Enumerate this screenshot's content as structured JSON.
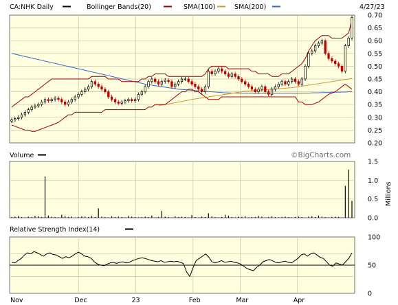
{
  "header": {
    "symbol_label": "CA:NHK Daily",
    "bollinger_label": "Bollinger Bands(20)",
    "sma100_label": "SMA(100)",
    "sma200_label": "SMA(200)",
    "date_label": "4/27/23"
  },
  "colors": {
    "panel_bg": "#ffffe0",
    "grid": "#c8c8a8",
    "up_candle": "#000000",
    "down_candle": "#c00000",
    "bollinger": "#a00000",
    "sma100": "#cc9933",
    "sma200": "#3366cc",
    "volume": "#000000",
    "rsi": "#000000"
  },
  "volume_panel": {
    "title": "Volume",
    "watermark": "©BigCharts.com",
    "unit_label": "Millions"
  },
  "rsi_panel": {
    "title": "Relative Strength Index(14)"
  },
  "chart_data": [
    {
      "type": "candlestick",
      "title": "CA:NHK Daily",
      "ylim": [
        0.2,
        0.7
      ],
      "y_ticks": [
        "0.70",
        "0.65",
        "0.60",
        "0.55",
        "0.50",
        "0.45",
        "0.40",
        "0.35",
        "0.30",
        "0.25",
        "0.20"
      ],
      "x_ticks": [
        "Nov",
        "Dec",
        "23",
        "Feb",
        "Mar",
        "Apr"
      ],
      "grid": true,
      "legend": [
        "Bollinger Bands(20)",
        "SMA(100)",
        "SMA(200)"
      ],
      "closes": [
        0.29,
        0.295,
        0.3,
        0.31,
        0.32,
        0.33,
        0.34,
        0.345,
        0.35,
        0.36,
        0.37,
        0.365,
        0.37,
        0.375,
        0.37,
        0.36,
        0.35,
        0.36,
        0.37,
        0.38,
        0.39,
        0.4,
        0.41,
        0.42,
        0.44,
        0.43,
        0.42,
        0.41,
        0.4,
        0.38,
        0.37,
        0.36,
        0.355,
        0.36,
        0.365,
        0.37,
        0.365,
        0.37,
        0.39,
        0.4,
        0.42,
        0.44,
        0.45,
        0.44,
        0.43,
        0.44,
        0.445,
        0.44,
        0.42,
        0.43,
        0.44,
        0.45,
        0.45,
        0.44,
        0.43,
        0.42,
        0.41,
        0.4,
        0.42,
        0.48,
        0.47,
        0.48,
        0.49,
        0.48,
        0.47,
        0.46,
        0.47,
        0.46,
        0.45,
        0.44,
        0.43,
        0.42,
        0.41,
        0.4,
        0.41,
        0.42,
        0.4,
        0.39,
        0.41,
        0.42,
        0.43,
        0.44,
        0.43,
        0.44,
        0.45,
        0.44,
        0.43,
        0.45,
        0.5,
        0.55,
        0.56,
        0.58,
        0.59,
        0.6,
        0.55,
        0.53,
        0.52,
        0.51,
        0.5,
        0.48,
        0.58,
        0.61,
        0.69
      ],
      "bollinger_upper": [
        0.34,
        0.35,
        0.36,
        0.37,
        0.38,
        0.38,
        0.39,
        0.4,
        0.41,
        0.42,
        0.43,
        0.44,
        0.45,
        0.45,
        0.45,
        0.45,
        0.45,
        0.45,
        0.45,
        0.45,
        0.45,
        0.45,
        0.45,
        0.45,
        0.46,
        0.46,
        0.46,
        0.46,
        0.46,
        0.45,
        0.45,
        0.45,
        0.45,
        0.44,
        0.44,
        0.44,
        0.44,
        0.44,
        0.44,
        0.45,
        0.45,
        0.46,
        0.46,
        0.47,
        0.47,
        0.47,
        0.47,
        0.46,
        0.46,
        0.46,
        0.46,
        0.46,
        0.46,
        0.46,
        0.46,
        0.46,
        0.46,
        0.46,
        0.47,
        0.49,
        0.5,
        0.5,
        0.5,
        0.5,
        0.5,
        0.49,
        0.49,
        0.49,
        0.49,
        0.49,
        0.49,
        0.49,
        0.48,
        0.48,
        0.47,
        0.47,
        0.47,
        0.47,
        0.46,
        0.46,
        0.46,
        0.47,
        0.47,
        0.47,
        0.48,
        0.49,
        0.5,
        0.51,
        0.53,
        0.56,
        0.58,
        0.6,
        0.61,
        0.62,
        0.62,
        0.62,
        0.61,
        0.61,
        0.61,
        0.61,
        0.62,
        0.63,
        0.68
      ],
      "bollinger_lower": [
        0.27,
        0.265,
        0.26,
        0.255,
        0.25,
        0.25,
        0.245,
        0.245,
        0.25,
        0.255,
        0.26,
        0.265,
        0.27,
        0.275,
        0.28,
        0.29,
        0.3,
        0.31,
        0.31,
        0.32,
        0.32,
        0.32,
        0.32,
        0.32,
        0.32,
        0.32,
        0.32,
        0.32,
        0.33,
        0.33,
        0.33,
        0.33,
        0.33,
        0.33,
        0.33,
        0.33,
        0.33,
        0.33,
        0.33,
        0.33,
        0.33,
        0.34,
        0.34,
        0.35,
        0.35,
        0.35,
        0.35,
        0.36,
        0.37,
        0.38,
        0.39,
        0.4,
        0.4,
        0.41,
        0.41,
        0.4,
        0.4,
        0.39,
        0.38,
        0.37,
        0.37,
        0.37,
        0.37,
        0.38,
        0.38,
        0.38,
        0.38,
        0.38,
        0.38,
        0.38,
        0.38,
        0.38,
        0.38,
        0.38,
        0.38,
        0.38,
        0.38,
        0.38,
        0.38,
        0.38,
        0.38,
        0.38,
        0.38,
        0.38,
        0.38,
        0.38,
        0.36,
        0.36,
        0.35,
        0.35,
        0.35,
        0.355,
        0.36,
        0.37,
        0.38,
        0.39,
        0.395,
        0.4,
        0.41,
        0.42,
        0.43,
        0.42,
        0.41
      ],
      "sma100": [
        null,
        null,
        null,
        null,
        null,
        null,
        null,
        null,
        null,
        null,
        null,
        null,
        null,
        null,
        null,
        null,
        null,
        null,
        null,
        null,
        null,
        null,
        null,
        null,
        null,
        null,
        null,
        null,
        null,
        null,
        null,
        null,
        null,
        null,
        null,
        null,
        null,
        null,
        null,
        null,
        null,
        null,
        null,
        null,
        0.345,
        0.348,
        0.35,
        0.352,
        0.355,
        0.357,
        0.36,
        0.362,
        0.365,
        0.367,
        0.37,
        0.372,
        0.374,
        0.376,
        0.378,
        0.38,
        0.382,
        0.384,
        0.386,
        0.388,
        0.39,
        0.392,
        0.394,
        0.396,
        0.398,
        0.4,
        0.402,
        0.403,
        0.404,
        0.405,
        0.406,
        0.407,
        0.408,
        0.409,
        0.41,
        0.411,
        0.412,
        0.413,
        0.414,
        0.415,
        0.416,
        0.418,
        0.42,
        0.422,
        0.424,
        0.426,
        0.428,
        0.43,
        0.432,
        0.434,
        0.436,
        0.438,
        0.44,
        0.442,
        0.444,
        0.446,
        0.448,
        0.45,
        0.452
      ],
      "sma200": [
        0.55,
        0.547,
        0.544,
        0.541,
        0.538,
        0.535,
        0.532,
        0.529,
        0.526,
        0.523,
        0.52,
        0.517,
        0.514,
        0.511,
        0.508,
        0.505,
        0.502,
        0.499,
        0.496,
        0.493,
        0.49,
        0.487,
        0.484,
        0.481,
        0.478,
        0.475,
        0.472,
        0.469,
        0.466,
        0.463,
        0.46,
        0.457,
        0.454,
        0.451,
        0.448,
        0.445,
        0.442,
        0.439,
        0.436,
        0.433,
        0.43,
        0.428,
        0.426,
        0.424,
        0.422,
        0.42,
        0.418,
        0.416,
        0.414,
        0.412,
        0.41,
        0.409,
        0.408,
        0.407,
        0.406,
        0.405,
        0.404,
        0.403,
        0.402,
        0.401,
        0.4,
        0.399,
        0.398,
        0.397,
        0.396,
        0.396,
        0.395,
        0.395,
        0.395,
        0.395,
        0.394,
        0.394,
        0.394,
        0.394,
        0.394,
        0.394,
        0.394,
        0.394,
        0.394,
        0.394,
        0.394,
        0.394,
        0.394,
        0.394,
        0.394,
        0.394,
        0.394,
        0.395,
        0.395,
        0.395,
        0.396,
        0.396,
        0.396,
        0.397,
        0.397,
        0.397,
        0.398,
        0.398,
        0.398,
        0.399,
        0.399,
        0.4,
        0.4
      ]
    },
    {
      "type": "bar",
      "title": "Volume",
      "ylim": [
        0,
        1.5
      ],
      "y_ticks": [
        "1.5",
        "1.0",
        "0.5",
        "0.0"
      ],
      "ylabel": "Millions",
      "values": [
        0.02,
        0.03,
        0.05,
        0.02,
        0.01,
        0.03,
        0.02,
        0.05,
        0.04,
        0.02,
        1.1,
        0.06,
        0.03,
        0.02,
        0.01,
        0.08,
        0.05,
        0.02,
        0.03,
        0.01,
        0.02,
        0.04,
        0.03,
        0.02,
        0.05,
        0.02,
        0.25,
        0.03,
        0.02,
        0.01,
        0.04,
        0.02,
        0.03,
        0.02,
        0.01,
        0.05,
        0.03,
        0.02,
        0.01,
        0.02,
        0.03,
        0.02,
        0.06,
        0.01,
        0.02,
        0.18,
        0.03,
        0.02,
        0.01,
        0.04,
        0.02,
        0.03,
        0.02,
        0.01,
        0.07,
        0.02,
        0.01,
        0.03,
        0.02,
        0.12,
        0.04,
        0.02,
        0.01,
        0.02,
        0.08,
        0.05,
        0.02,
        0.01,
        0.03,
        0.02,
        0.04,
        0.01,
        0.02,
        0.02,
        0.05,
        0.03,
        0.01,
        0.02,
        0.04,
        0.02,
        0.01,
        0.02,
        0.03,
        0.02,
        0.01,
        0.02,
        0.03,
        0.02,
        0.01,
        0.03,
        0.04,
        0.02,
        0.06,
        0.03,
        0.02,
        0.01,
        0.02,
        0.03,
        0.02,
        0.01,
        0.85,
        1.28,
        0.45
      ]
    },
    {
      "type": "line",
      "title": "Relative Strength Index(14)",
      "ylim": [
        0,
        100
      ],
      "y_ticks": [
        "100",
        "50",
        "0"
      ],
      "reference_line": 50,
      "values": [
        55,
        54,
        58,
        62,
        68,
        72,
        70,
        74,
        72,
        69,
        66,
        70,
        72,
        69,
        68,
        65,
        62,
        65,
        63,
        66,
        70,
        73,
        70,
        66,
        65,
        62,
        56,
        52,
        50,
        49,
        52,
        54,
        55,
        53,
        55,
        56,
        54,
        55,
        58,
        60,
        62,
        63,
        62,
        60,
        58,
        57,
        56,
        58,
        55,
        56,
        57,
        56,
        57,
        55,
        53,
        38,
        30,
        45,
        58,
        62,
        66,
        70,
        64,
        56,
        54,
        56,
        58,
        55,
        56,
        57,
        55,
        54,
        52,
        48,
        44,
        42,
        40,
        46,
        50,
        56,
        58,
        60,
        58,
        55,
        54,
        56,
        57,
        55,
        54,
        58,
        62,
        68,
        70,
        66,
        70,
        72,
        68,
        64,
        62,
        56,
        50,
        48,
        54,
        52,
        50,
        56,
        62,
        72
      ]
    }
  ]
}
